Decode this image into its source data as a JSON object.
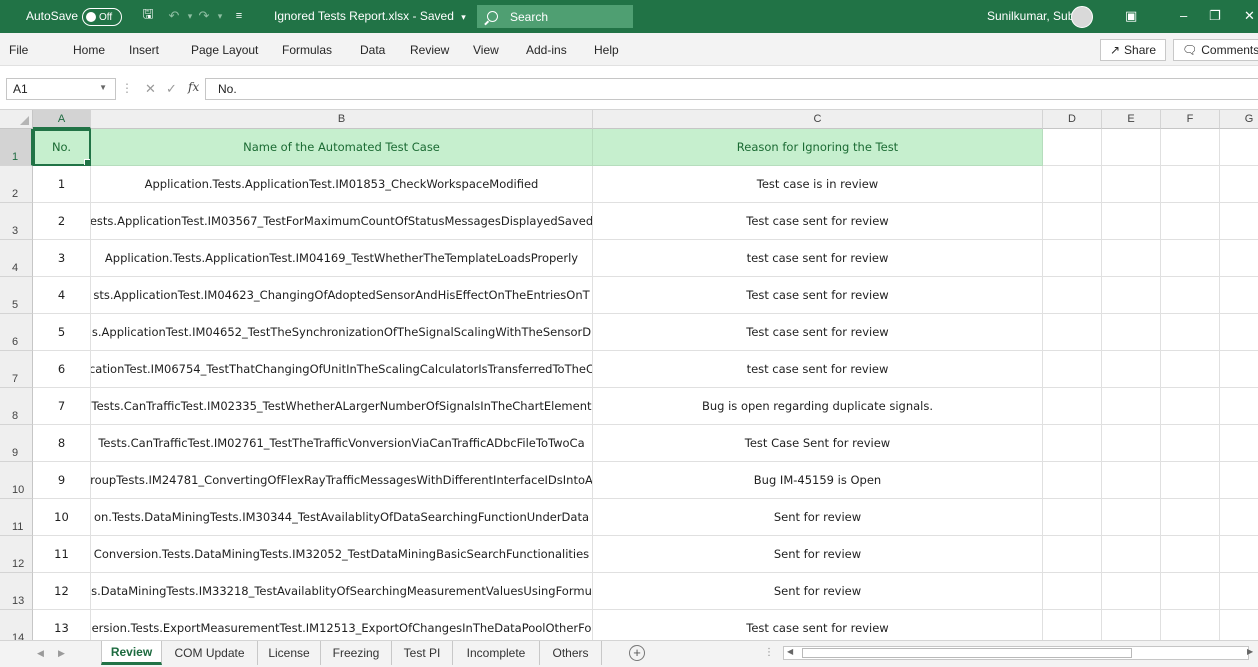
{
  "titlebar": {
    "autosave_label": "AutoSave",
    "autosave_state": "Off",
    "filename": "Ignored Tests Report.xlsx  -  Saved",
    "search_label": "Search",
    "user_name": "Sunilkumar, Subin",
    "save_icon": "save-icon",
    "colors": {
      "bar": "#217346"
    }
  },
  "ribbon": {
    "tabs": [
      "File",
      "Home",
      "Insert",
      "Page Layout",
      "Formulas",
      "Data",
      "Review",
      "View",
      "Add-ins",
      "Help"
    ],
    "share_label": "Share",
    "comments_label": "Comments"
  },
  "formula_bar": {
    "name_box": "A1",
    "fx_label": "fx",
    "value": "No."
  },
  "columns": [
    "A",
    "B",
    "C",
    "D",
    "E",
    "F",
    "G"
  ],
  "sheet": {
    "header": {
      "a": "No.",
      "b": "Name of the Automated Test Case",
      "c": "Reason for Ignoring the Test"
    },
    "rows": [
      {
        "row": "2",
        "no": "1",
        "name": "Application.Tests.ApplicationTest.IM01853_CheckWorkspaceModified",
        "reason": "Test case is in review"
      },
      {
        "row": "3",
        "no": "2",
        "name": "ests.ApplicationTest.IM03567_TestForMaximumCountOfStatusMessagesDisplayedSaved",
        "reason": "Test case sent for review"
      },
      {
        "row": "4",
        "no": "3",
        "name": "Application.Tests.ApplicationTest.IM04169_TestWhetherTheTemplateLoadsProperly",
        "reason": "test case sent for review"
      },
      {
        "row": "5",
        "no": "4",
        "name": "sts.ApplicationTest.IM04623_ChangingOfAdoptedSensorAndHisEffectOnTheEntriesOnT",
        "reason": "Test case sent for review"
      },
      {
        "row": "6",
        "no": "5",
        "name": "s.ApplicationTest.IM04652_TestTheSynchronizationOfTheSignalScalingWithTheSensorD",
        "reason": "Test case sent for review"
      },
      {
        "row": "7",
        "no": "6",
        "name": "cationTest.IM06754_TestThatChangingOfUnitInTheScalingCalculatorIsTransferredToTheC",
        "reason": "test case sent for review"
      },
      {
        "row": "8",
        "no": "7",
        "name": "Tests.CanTrafficTest.IM02335_TestWhetherALargerNumberOfSignalsInTheChartElement",
        "reason": "Bug is open regarding duplicate signals."
      },
      {
        "row": "9",
        "no": "8",
        "name": "Tests.CanTrafficTest.IM02761_TestTheTrafficVonversionViaCanTrafficADbcFileToTwoCa",
        "reason": "Test Case Sent for review"
      },
      {
        "row": "10",
        "no": "9",
        "name": "roupTests.IM24781_ConvertingOfFlexRayTrafficMessagesWithDifferentInterfaceIDsIntoA",
        "reason": "Bug IM-45159 is Open"
      },
      {
        "row": "11",
        "no": "10",
        "name": "on.Tests.DataMiningTests.IM30344_TestAvailablityOfDataSearchingFunctionUnderData",
        "reason": "Sent for review"
      },
      {
        "row": "12",
        "no": "11",
        "name": "Conversion.Tests.DataMiningTests.IM32052_TestDataMiningBasicSearchFunctionalities",
        "reason": "Sent for review"
      },
      {
        "row": "13",
        "no": "12",
        "name": "s.DataMiningTests.IM33218_TestAvailablityOfSearchingMeasurementValuesUsingFormu",
        "reason": "Sent for review"
      },
      {
        "row": "14",
        "no": "13",
        "name": "ersion.Tests.ExportMeasurementTest.IM12513_ExportOfChangesInTheDataPoolOtherFo",
        "reason": "Test case sent for review"
      }
    ],
    "header_row": "1",
    "colors": {
      "header_fill": "#c6efce",
      "header_text": "#1b6b33"
    }
  },
  "sheet_tabs": [
    "Review",
    "COM Update",
    "License",
    "Freezing",
    "Test PI",
    "Incomplete",
    "Others"
  ],
  "active_sheet": "Review"
}
